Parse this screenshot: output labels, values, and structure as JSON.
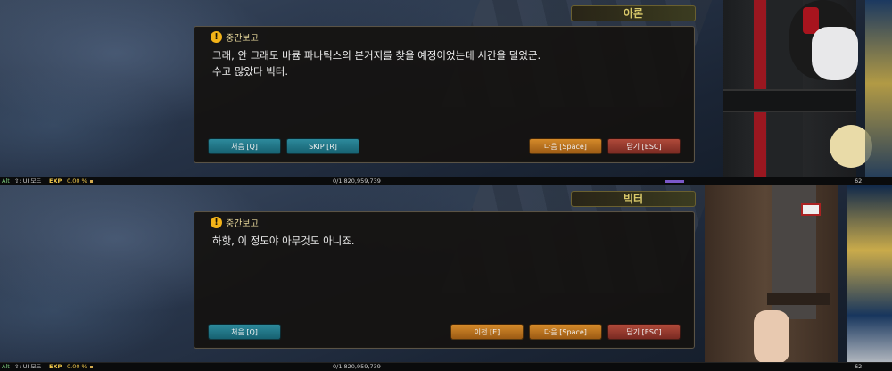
{
  "panels": [
    {
      "speaker": "아론",
      "header_title": "중간보고",
      "lines": [
        "그래, 안 그래도 바큠 파나틱스의 본거지를 찾을 예정이었는데 시간을 덜었군.",
        "수고 많았다 빅터."
      ],
      "buttons": {
        "first": "처음 [Q]",
        "skip": "SKIP [R]",
        "next": "다음 [Space]",
        "close": "닫기 [ESC]"
      },
      "status": {
        "alt": "Alt",
        "ui_mode": "⇧: UI 모드",
        "exp_label": "EXP",
        "exp_percent": "0.00 %",
        "exp_value": "0/1,820,959,739",
        "level": "62"
      }
    },
    {
      "speaker": "빅터",
      "header_title": "중간보고",
      "lines": [
        "하핫, 이 정도야 아무것도 아니죠."
      ],
      "buttons": {
        "first": "처음 [Q]",
        "prev": "이전 [E]",
        "next": "다음 [Space]",
        "close": "닫기 [ESC]"
      },
      "status": {
        "alt": "Alt",
        "ui_mode": "⇧: UI 모드",
        "exp_label": "EXP",
        "exp_percent": "0.00 %",
        "exp_value": "0/1,820,959,739",
        "level": "62"
      }
    }
  ],
  "colors": {
    "warn": "#f3b318",
    "teal_button": "#2d8a9c",
    "orange_button": "#d58a2a",
    "red_button": "#b04a3a",
    "speaker_text": "#d9c96a"
  },
  "icons": {
    "header": "warning-icon"
  }
}
